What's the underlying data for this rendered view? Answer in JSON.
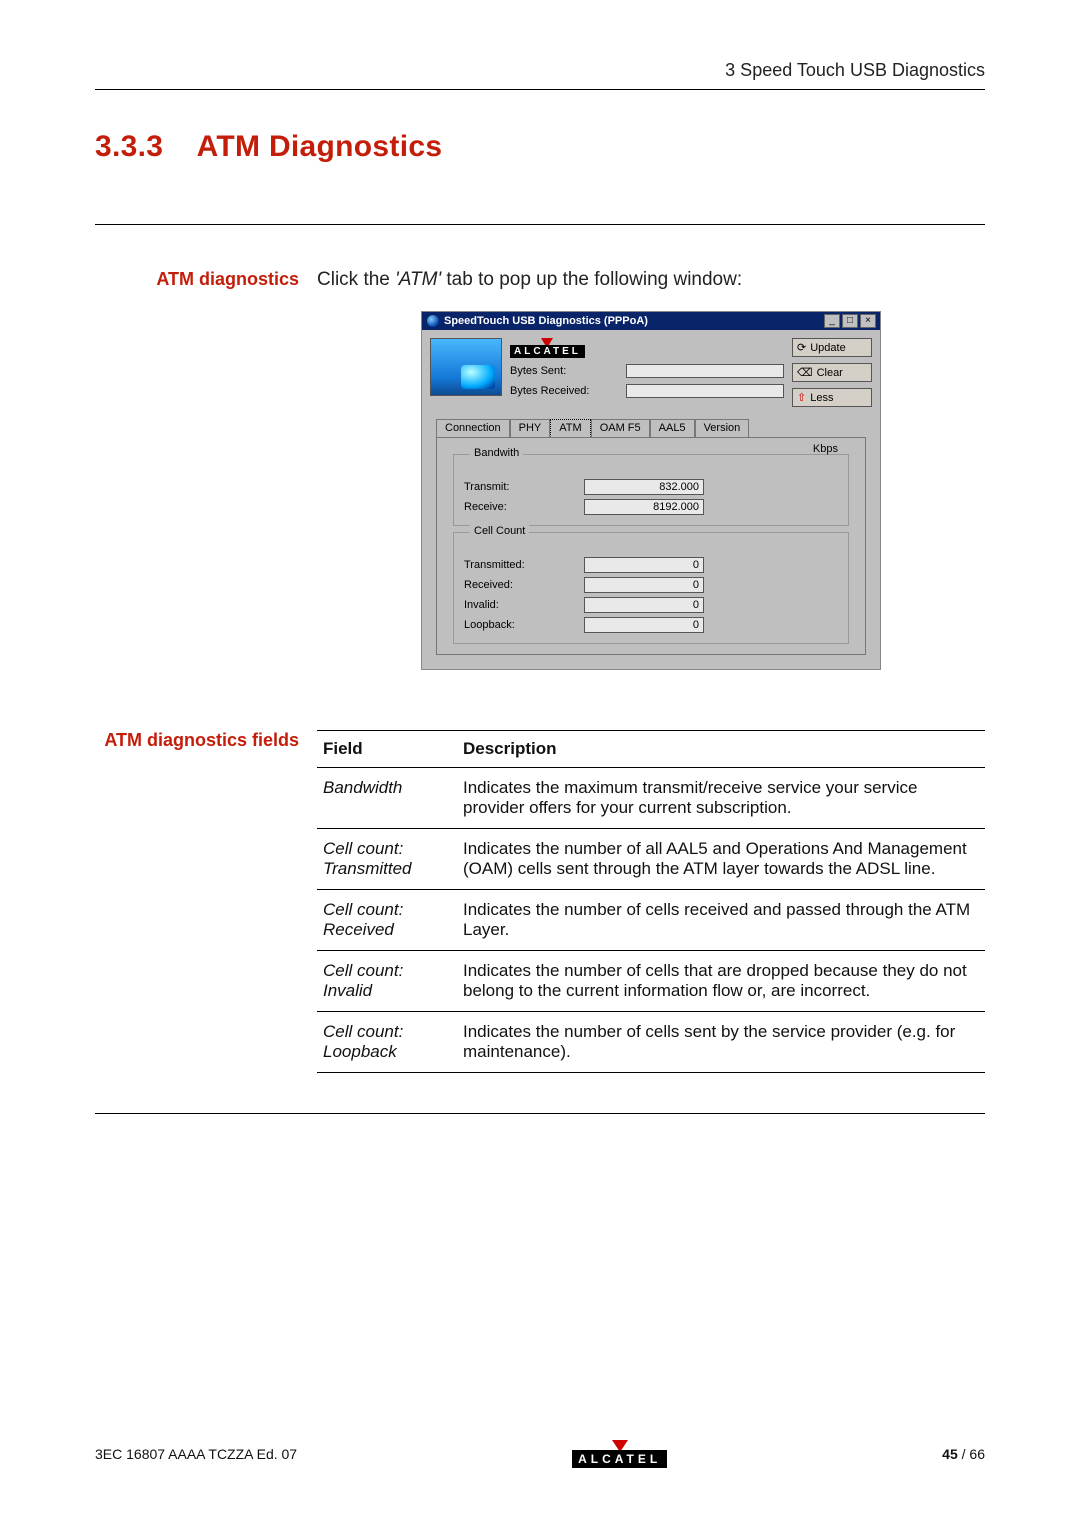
{
  "header": {
    "chapter": "3   Speed Touch USB Diagnostics"
  },
  "section": {
    "number": "3.3.3",
    "title": "ATM Diagnostics"
  },
  "intro": {
    "label": "ATM diagnostics",
    "text_prefix": "Click the ",
    "text_em": "'ATM'",
    "text_suffix": " tab to pop up the following window:"
  },
  "window": {
    "title": "SpeedTouch USB Diagnostics (PPPoA)",
    "brand": "ALCATEL",
    "bytes_sent_label": "Bytes Sent:",
    "bytes_recv_label": "Bytes Received:",
    "buttons": {
      "update": "Update",
      "clear": "Clear",
      "less": "Less"
    },
    "tabs": [
      "Connection",
      "PHY",
      "ATM",
      "OAM F5",
      "AAL5",
      "Version"
    ],
    "active_tab_index": 2,
    "bandwidth": {
      "group": "Bandwith",
      "kbps": "Kbps",
      "transmit_label": "Transmit:",
      "transmit_value": "832.000",
      "receive_label": "Receive:",
      "receive_value": "8192.000"
    },
    "cellcount": {
      "group": "Cell Count",
      "rows": [
        {
          "label": "Transmitted:",
          "value": "0"
        },
        {
          "label": "Received:",
          "value": "0"
        },
        {
          "label": "Invalid:",
          "value": "0"
        },
        {
          "label": "Loopback:",
          "value": "0"
        }
      ]
    }
  },
  "fields": {
    "label": "ATM diagnostics fields",
    "headers": {
      "field": "Field",
      "description": "Description"
    },
    "rows": [
      {
        "field": "Bandwidth",
        "desc": "Indicates the maximum transmit/receive service your service provider offers for your current subscription."
      },
      {
        "field": "Cell count: Transmitted",
        "desc": "Indicates the number of all AAL5 and Operations And Management (OAM) cells sent through the ATM layer towards the ADSL line."
      },
      {
        "field": "Cell count: Received",
        "desc": "Indicates the number of cells received and passed through the ATM Layer."
      },
      {
        "field": "Cell count: Invalid",
        "desc": "Indicates the number of cells that are dropped because they do not belong to the current information flow or, are incorrect."
      },
      {
        "field": "Cell count: Loopback",
        "desc": "Indicates the number of cells sent by the service provider (e.g. for maintenance)."
      }
    ]
  },
  "footer": {
    "docref": "3EC 16807 AAAA TCZZA Ed. 07",
    "brand": "ALCATEL",
    "page_current": "45",
    "page_total": "66"
  },
  "chart_data": {
    "type": "table",
    "title": "ATM Bandwidth and Cell Count",
    "bandwidth_kbps": {
      "Transmit": 832.0,
      "Receive": 8192.0
    },
    "cell_count": {
      "Transmitted": 0,
      "Received": 0,
      "Invalid": 0,
      "Loopback": 0
    }
  }
}
